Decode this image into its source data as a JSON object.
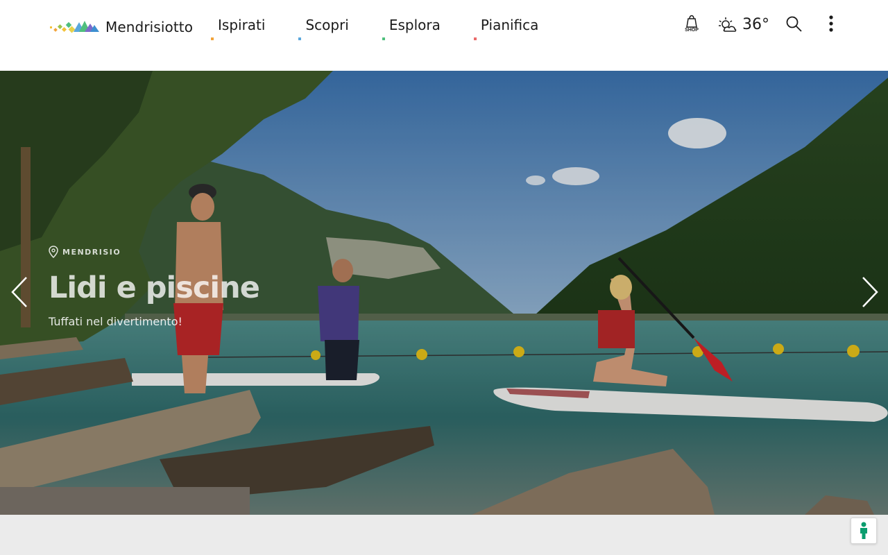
{
  "brand": {
    "name": "Mendrisiotto",
    "logo_icon": "mendrisiotto-logo-icon"
  },
  "nav": {
    "items": [
      {
        "label": "Ispirati",
        "accent": "#f2a33a"
      },
      {
        "label": "Scopri",
        "accent": "#5aa7dd"
      },
      {
        "label": "Esplora",
        "accent": "#4fbf7d"
      },
      {
        "label": "Pianifica",
        "accent": "#ea6a6a"
      }
    ]
  },
  "tools": {
    "shop_label": "SHOP",
    "weather_icon": "sun-cloud-icon",
    "temperature": "36°",
    "search_icon": "search-icon",
    "menu_icon": "vertical-dots-icon"
  },
  "hero": {
    "location": "MENDRISIO",
    "title": "Lidi e piscine",
    "subtitle": "Tuffati nel divertimento!",
    "prev_icon": "chevron-left-icon",
    "next_icon": "chevron-right-icon"
  },
  "floating_button": {
    "icon": "person-icon",
    "color": "#0a9d6e"
  }
}
